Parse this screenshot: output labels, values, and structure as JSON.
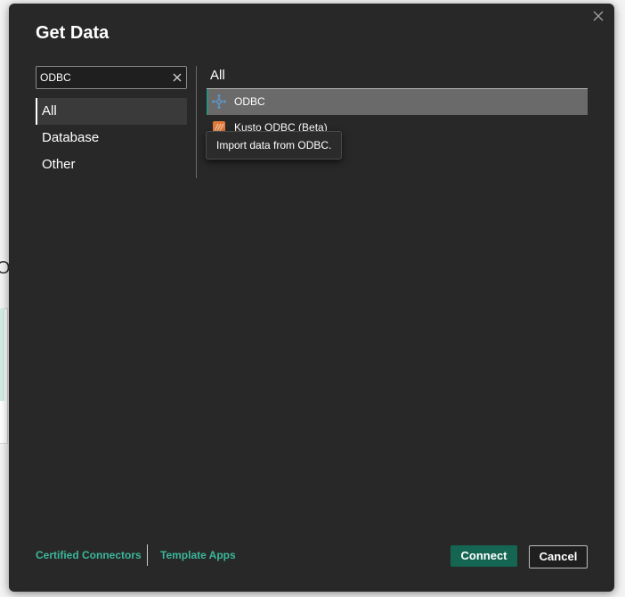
{
  "background": {
    "partial_text": "Or"
  },
  "dialog": {
    "title": "Get Data",
    "search": {
      "value": "ODBC",
      "placeholder": ""
    },
    "categories": [
      {
        "label": "All",
        "selected": true
      },
      {
        "label": "Database",
        "selected": false
      },
      {
        "label": "Other",
        "selected": false
      }
    ],
    "list_header": "All",
    "connectors": [
      {
        "label": "ODBC",
        "icon": "odbc-icon",
        "selected": true
      },
      {
        "label": "Kusto ODBC (Beta)",
        "icon": "kusto-odbc-icon",
        "selected": false
      }
    ],
    "tooltip": "Import data from ODBC.",
    "footer": {
      "certified_connectors": "Certified Connectors",
      "template_apps": "Template Apps",
      "connect_label": "Connect",
      "cancel_label": "Cancel"
    }
  },
  "colors": {
    "dialog_bg": "#282828",
    "accent_link": "#3bb79c",
    "connect_button": "#146652",
    "selected_row": "#6a6a6a"
  }
}
